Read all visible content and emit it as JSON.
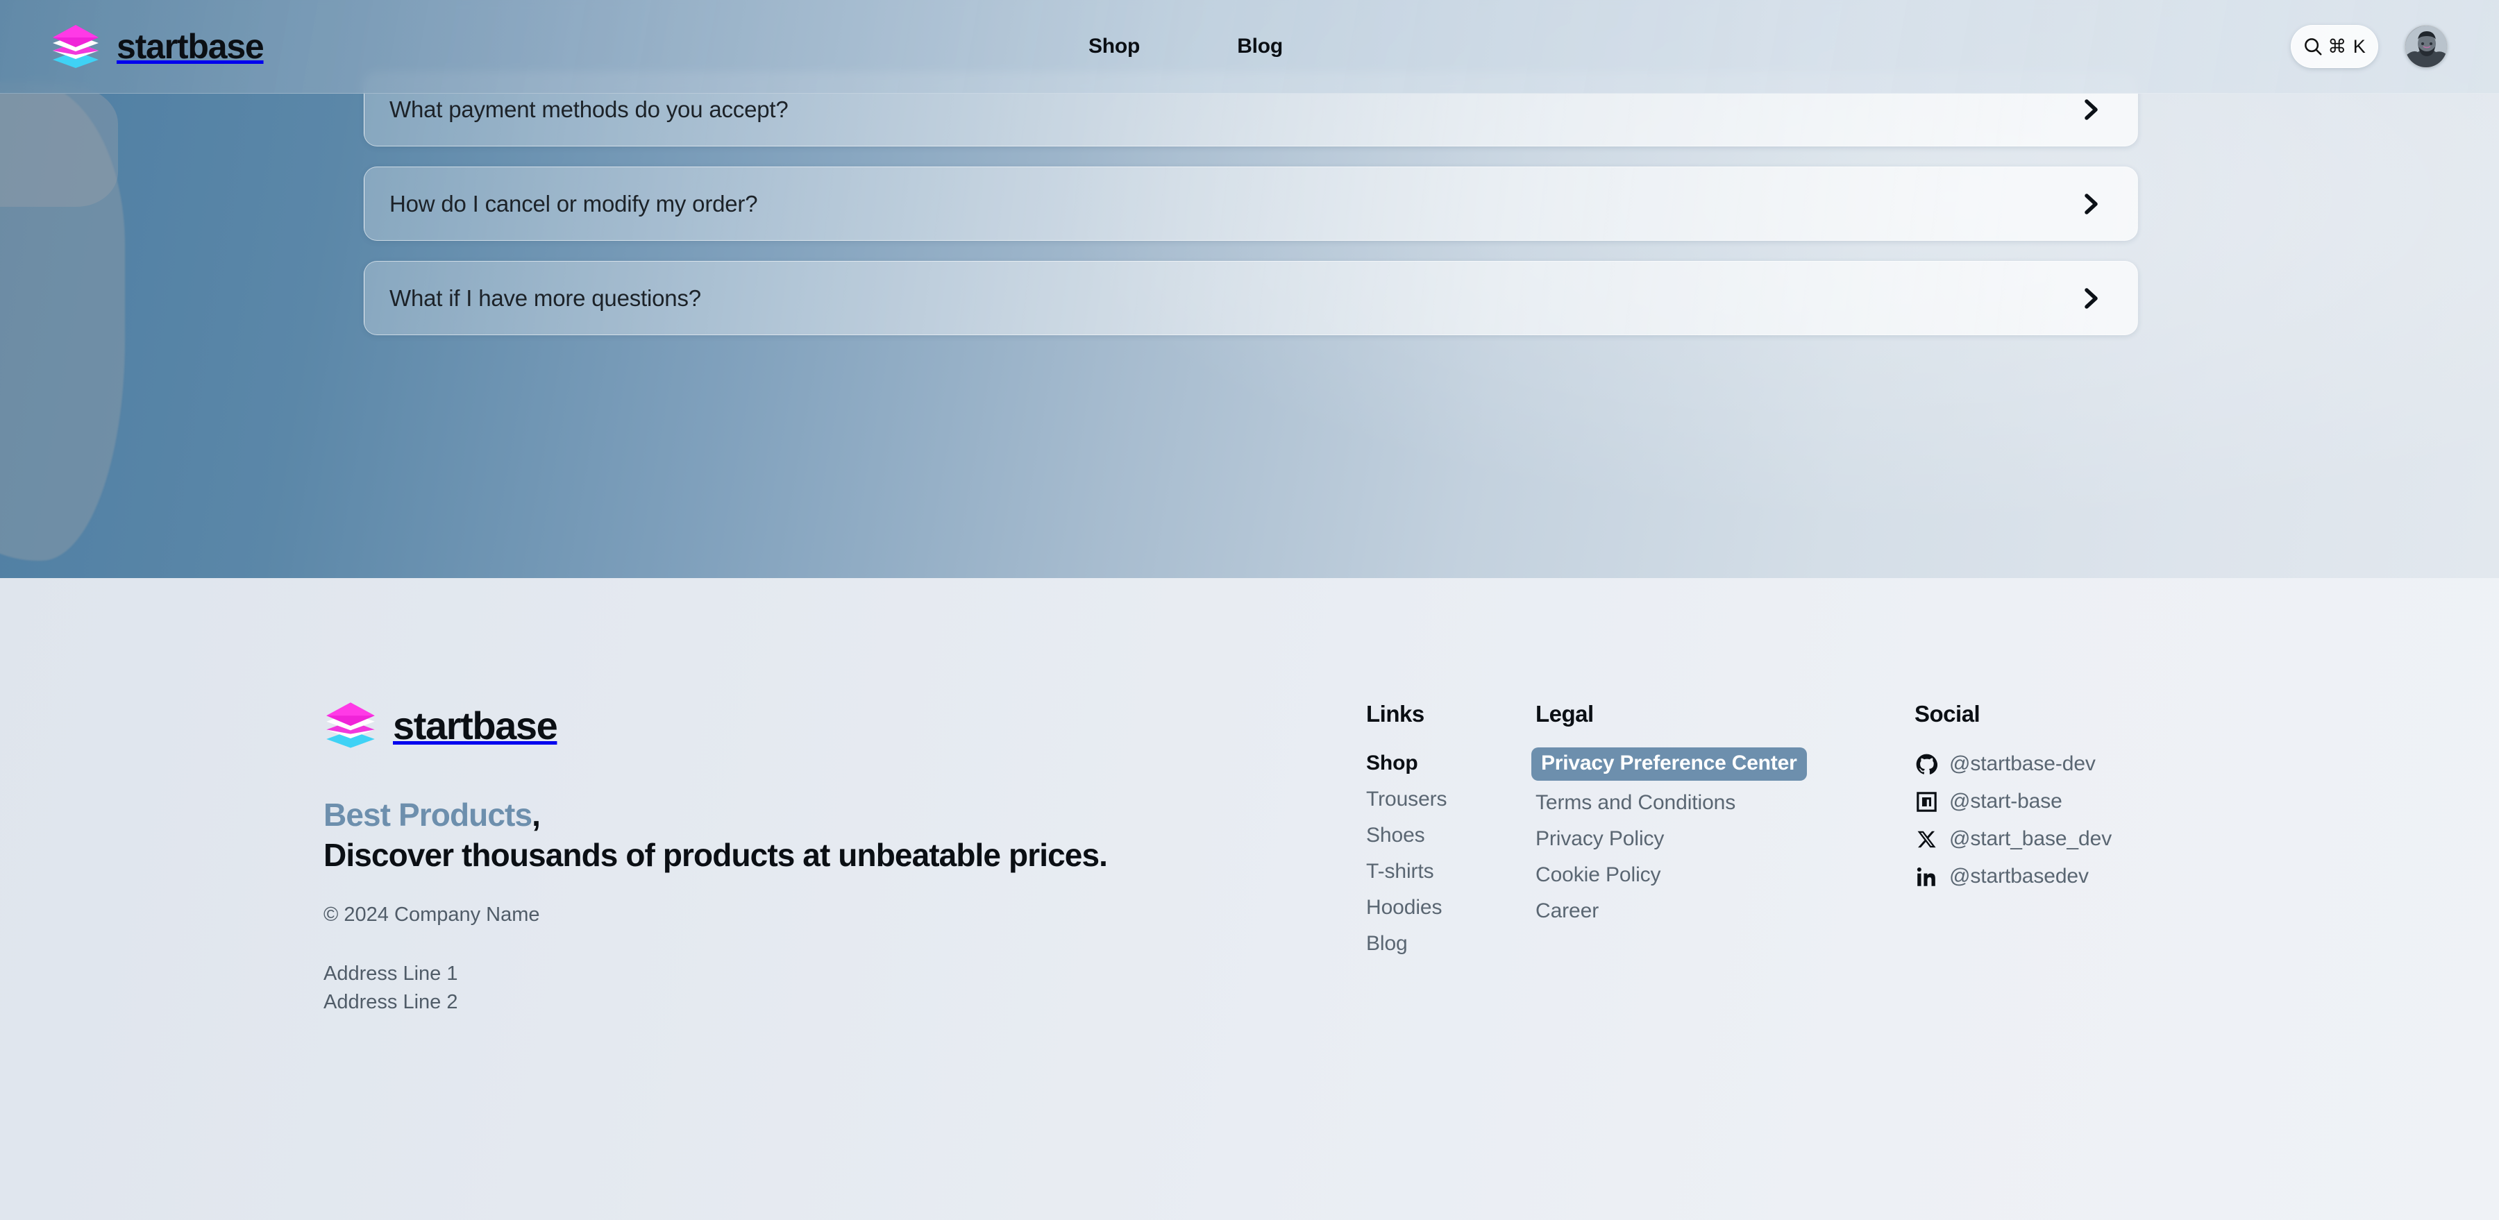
{
  "brand": {
    "name": "startbase"
  },
  "header": {
    "nav": [
      {
        "label": "Shop"
      },
      {
        "label": "Blog"
      }
    ],
    "search": {
      "shortcut": "⌘ K",
      "icon": "search-icon"
    },
    "avatar": {
      "icon": "user-avatar"
    }
  },
  "faq": {
    "items": [
      {
        "question": "What payment methods do you accept?",
        "chevron": "chevron-right-icon"
      },
      {
        "question": "How do I cancel or modify my order?",
        "chevron": "chevron-right-icon"
      },
      {
        "question": "What if I have more questions?",
        "chevron": "chevron-right-icon"
      }
    ]
  },
  "footer": {
    "brand_name": "startbase",
    "tagline_accent": "Best Products",
    "tagline_comma": ",",
    "tagline_rest": "Discover thousands of products at unbeatable prices.",
    "copyright": "© 2024 Company Name",
    "address": [
      "Address Line 1",
      "Address Line 2"
    ],
    "columns": {
      "links": {
        "title": "Links",
        "items": [
          {
            "label": "Shop",
            "bold": true
          },
          {
            "label": "Trousers",
            "bold": false
          },
          {
            "label": "Shoes",
            "bold": false
          },
          {
            "label": "T-shirts",
            "bold": false
          },
          {
            "label": "Hoodies",
            "bold": false
          },
          {
            "label": "Blog",
            "bold": false
          }
        ]
      },
      "legal": {
        "title": "Legal",
        "items": [
          {
            "label": "Privacy Preference Center",
            "highlight": true
          },
          {
            "label": "Terms and Conditions",
            "highlight": false
          },
          {
            "label": "Privacy Policy",
            "highlight": false
          },
          {
            "label": "Cookie Policy",
            "highlight": false
          },
          {
            "label": "Career",
            "highlight": false
          }
        ]
      },
      "social": {
        "title": "Social",
        "items": [
          {
            "icon": "github-icon",
            "handle": "@startbase-dev"
          },
          {
            "icon": "npm-icon",
            "handle": "@start-base"
          },
          {
            "icon": "x-twitter-icon",
            "handle": "@start_base_dev"
          },
          {
            "icon": "linkedin-icon",
            "handle": "@startbasedev"
          }
        ]
      }
    }
  },
  "colors": {
    "logo_magenta": "#f023d8",
    "logo_cyan": "#3fd2f5",
    "hero_blue_left": "#4e7ea3",
    "accent_steel": "#6d8fad",
    "footer_bg": "#e9edf3",
    "text_dark": "#0b0f14",
    "text_muted": "#5a6672"
  }
}
